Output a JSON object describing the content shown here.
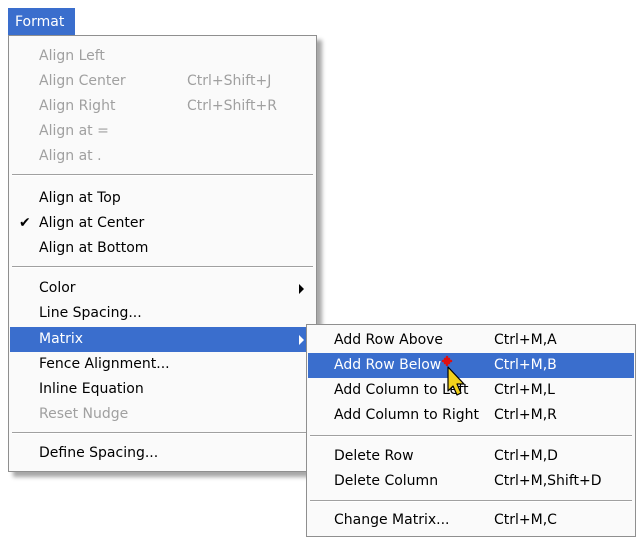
{
  "menubar": {
    "title": "Format"
  },
  "format_menu": {
    "align_left": "Align Left",
    "align_center": {
      "label": "Align Center",
      "shortcut": "Ctrl+Shift+J"
    },
    "align_right": {
      "label": "Align Right",
      "shortcut": "Ctrl+Shift+R"
    },
    "align_at_eq": "Align at =",
    "align_at_dot": "Align at .",
    "align_top": "Align at Top",
    "align_at_center": "Align at Center",
    "align_at_center_check": "✔",
    "align_bottom": "Align at Bottom",
    "color": "Color",
    "line_spacing": "Line Spacing...",
    "matrix": "Matrix",
    "fence_alignment": "Fence Alignment...",
    "inline_equation": "Inline Equation",
    "reset_nudge": "Reset Nudge",
    "define_spacing": "Define Spacing..."
  },
  "matrix_submenu": {
    "add_row_above": {
      "label": "Add Row Above",
      "shortcut": "Ctrl+M,A"
    },
    "add_row_below": {
      "label": "Add Row Below",
      "shortcut": "Ctrl+M,B"
    },
    "add_column_left": {
      "label": "Add Column to Left",
      "shortcut": "Ctrl+M,L"
    },
    "add_column_right": {
      "label": "Add Column to Right",
      "shortcut": "Ctrl+M,R"
    },
    "delete_row": {
      "label": "Delete Row",
      "shortcut": "Ctrl+M,D"
    },
    "delete_column": {
      "label": "Delete Column",
      "shortcut": "Ctrl+M,Shift+D"
    },
    "change_matrix": {
      "label": "Change Matrix...",
      "shortcut": "Ctrl+M,C"
    }
  },
  "colors": {
    "highlight": "#3a6ecd",
    "disabled": "#a0a0a0"
  },
  "icons": {
    "check": "check-icon",
    "submenu_arrow": "submenu-arrow-icon",
    "cursor": "mouse-cursor-icon"
  }
}
